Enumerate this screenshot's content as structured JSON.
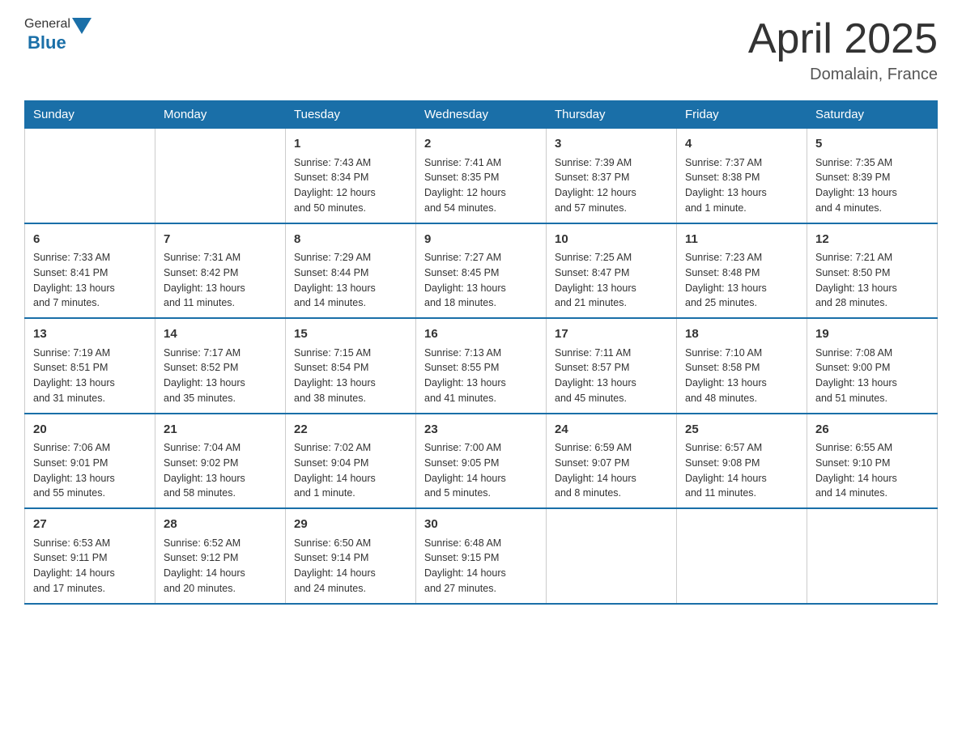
{
  "header": {
    "logo_general": "General",
    "logo_blue": "Blue",
    "month_title": "April 2025",
    "location": "Domalain, France"
  },
  "weekdays": [
    "Sunday",
    "Monday",
    "Tuesday",
    "Wednesday",
    "Thursday",
    "Friday",
    "Saturday"
  ],
  "weeks": [
    [
      {
        "day": "",
        "info": ""
      },
      {
        "day": "",
        "info": ""
      },
      {
        "day": "1",
        "info": "Sunrise: 7:43 AM\nSunset: 8:34 PM\nDaylight: 12 hours\nand 50 minutes."
      },
      {
        "day": "2",
        "info": "Sunrise: 7:41 AM\nSunset: 8:35 PM\nDaylight: 12 hours\nand 54 minutes."
      },
      {
        "day": "3",
        "info": "Sunrise: 7:39 AM\nSunset: 8:37 PM\nDaylight: 12 hours\nand 57 minutes."
      },
      {
        "day": "4",
        "info": "Sunrise: 7:37 AM\nSunset: 8:38 PM\nDaylight: 13 hours\nand 1 minute."
      },
      {
        "day": "5",
        "info": "Sunrise: 7:35 AM\nSunset: 8:39 PM\nDaylight: 13 hours\nand 4 minutes."
      }
    ],
    [
      {
        "day": "6",
        "info": "Sunrise: 7:33 AM\nSunset: 8:41 PM\nDaylight: 13 hours\nand 7 minutes."
      },
      {
        "day": "7",
        "info": "Sunrise: 7:31 AM\nSunset: 8:42 PM\nDaylight: 13 hours\nand 11 minutes."
      },
      {
        "day": "8",
        "info": "Sunrise: 7:29 AM\nSunset: 8:44 PM\nDaylight: 13 hours\nand 14 minutes."
      },
      {
        "day": "9",
        "info": "Sunrise: 7:27 AM\nSunset: 8:45 PM\nDaylight: 13 hours\nand 18 minutes."
      },
      {
        "day": "10",
        "info": "Sunrise: 7:25 AM\nSunset: 8:47 PM\nDaylight: 13 hours\nand 21 minutes."
      },
      {
        "day": "11",
        "info": "Sunrise: 7:23 AM\nSunset: 8:48 PM\nDaylight: 13 hours\nand 25 minutes."
      },
      {
        "day": "12",
        "info": "Sunrise: 7:21 AM\nSunset: 8:50 PM\nDaylight: 13 hours\nand 28 minutes."
      }
    ],
    [
      {
        "day": "13",
        "info": "Sunrise: 7:19 AM\nSunset: 8:51 PM\nDaylight: 13 hours\nand 31 minutes."
      },
      {
        "day": "14",
        "info": "Sunrise: 7:17 AM\nSunset: 8:52 PM\nDaylight: 13 hours\nand 35 minutes."
      },
      {
        "day": "15",
        "info": "Sunrise: 7:15 AM\nSunset: 8:54 PM\nDaylight: 13 hours\nand 38 minutes."
      },
      {
        "day": "16",
        "info": "Sunrise: 7:13 AM\nSunset: 8:55 PM\nDaylight: 13 hours\nand 41 minutes."
      },
      {
        "day": "17",
        "info": "Sunrise: 7:11 AM\nSunset: 8:57 PM\nDaylight: 13 hours\nand 45 minutes."
      },
      {
        "day": "18",
        "info": "Sunrise: 7:10 AM\nSunset: 8:58 PM\nDaylight: 13 hours\nand 48 minutes."
      },
      {
        "day": "19",
        "info": "Sunrise: 7:08 AM\nSunset: 9:00 PM\nDaylight: 13 hours\nand 51 minutes."
      }
    ],
    [
      {
        "day": "20",
        "info": "Sunrise: 7:06 AM\nSunset: 9:01 PM\nDaylight: 13 hours\nand 55 minutes."
      },
      {
        "day": "21",
        "info": "Sunrise: 7:04 AM\nSunset: 9:02 PM\nDaylight: 13 hours\nand 58 minutes."
      },
      {
        "day": "22",
        "info": "Sunrise: 7:02 AM\nSunset: 9:04 PM\nDaylight: 14 hours\nand 1 minute."
      },
      {
        "day": "23",
        "info": "Sunrise: 7:00 AM\nSunset: 9:05 PM\nDaylight: 14 hours\nand 5 minutes."
      },
      {
        "day": "24",
        "info": "Sunrise: 6:59 AM\nSunset: 9:07 PM\nDaylight: 14 hours\nand 8 minutes."
      },
      {
        "day": "25",
        "info": "Sunrise: 6:57 AM\nSunset: 9:08 PM\nDaylight: 14 hours\nand 11 minutes."
      },
      {
        "day": "26",
        "info": "Sunrise: 6:55 AM\nSunset: 9:10 PM\nDaylight: 14 hours\nand 14 minutes."
      }
    ],
    [
      {
        "day": "27",
        "info": "Sunrise: 6:53 AM\nSunset: 9:11 PM\nDaylight: 14 hours\nand 17 minutes."
      },
      {
        "day": "28",
        "info": "Sunrise: 6:52 AM\nSunset: 9:12 PM\nDaylight: 14 hours\nand 20 minutes."
      },
      {
        "day": "29",
        "info": "Sunrise: 6:50 AM\nSunset: 9:14 PM\nDaylight: 14 hours\nand 24 minutes."
      },
      {
        "day": "30",
        "info": "Sunrise: 6:48 AM\nSunset: 9:15 PM\nDaylight: 14 hours\nand 27 minutes."
      },
      {
        "day": "",
        "info": ""
      },
      {
        "day": "",
        "info": ""
      },
      {
        "day": "",
        "info": ""
      }
    ]
  ]
}
